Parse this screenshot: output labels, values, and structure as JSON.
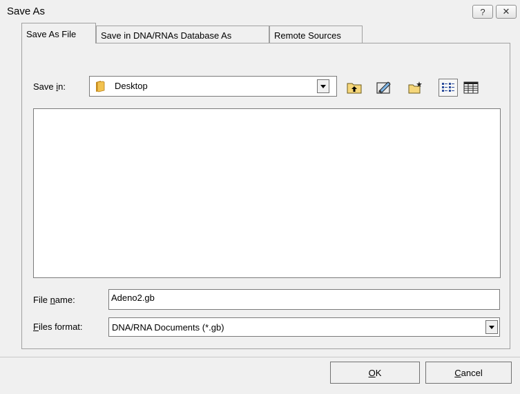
{
  "window": {
    "title": "Save As",
    "help_button": "?",
    "close_button": "✕"
  },
  "tabs": [
    {
      "label": "Save As File",
      "active": true
    },
    {
      "label": "Save in DNA/RNAs Database As",
      "active": false
    },
    {
      "label": "Remote Sources",
      "active": false
    }
  ],
  "save_in": {
    "label_prefix": "Save ",
    "label_accel": "i",
    "label_suffix": "n:",
    "value": "Desktop",
    "icon": "folder-icon"
  },
  "toolbar": {
    "up_folder_icon": "up-folder-icon",
    "desktop_icon": "desktop-icon",
    "new_folder_icon": "new-folder-icon",
    "list_view_icon": "list-view-icon",
    "details_view_icon": "details-view-icon"
  },
  "file_name": {
    "label_prefix": "File ",
    "label_accel": "n",
    "label_suffix": "ame:",
    "value": "Adeno2.gb"
  },
  "files_format": {
    "label_accel": "F",
    "label_suffix": "iles format:",
    "value": "DNA/RNA Documents (*.gb)"
  },
  "buttons": {
    "ok_accel": "O",
    "ok_rest": "K",
    "cancel_accel": "C",
    "cancel_rest": "ancel"
  },
  "colors": {
    "background": "#f0f0f0",
    "folder": "#e8b84a",
    "border": "#7a7a7a"
  }
}
